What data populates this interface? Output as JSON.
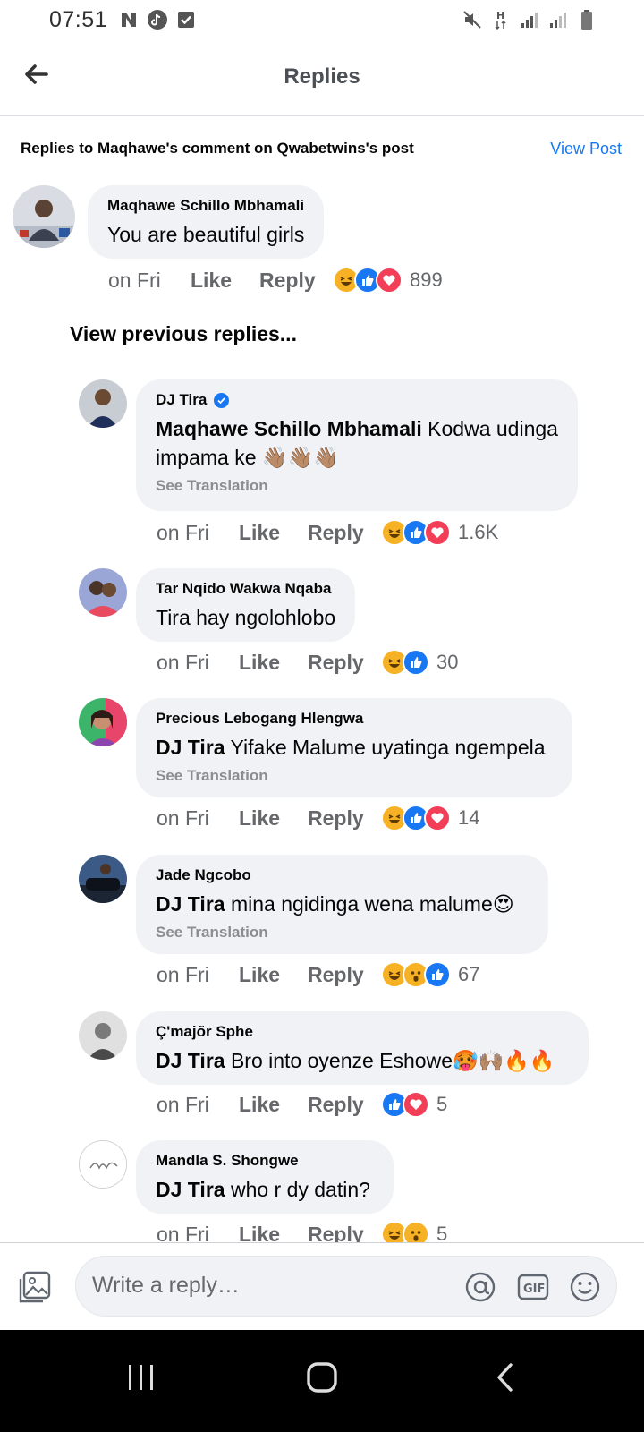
{
  "status_bar": {
    "time": "07:51",
    "left_icons": [
      "netflix-n-icon",
      "tiktok-icon",
      "checkbox-icon"
    ],
    "right_icons": [
      "mute-icon",
      "data-h-icon",
      "signal-icon",
      "signal-icon",
      "battery-icon"
    ]
  },
  "header": {
    "back_icon": "arrow-left-icon",
    "title": "Replies"
  },
  "context": {
    "text": "Replies to Maqhawe's comment on Qwabetwins's post",
    "view_post": "View Post"
  },
  "main_comment": {
    "author": "Maqhawe Schillo Mbhamali",
    "text": "You are beautiful girls",
    "time": "on Fri",
    "like_label": "Like",
    "reply_label": "Reply",
    "reactions": [
      "haha",
      "like",
      "love"
    ],
    "reaction_count": "899"
  },
  "view_previous": "View previous replies...",
  "replies": [
    {
      "author": "DJ Tira",
      "verified": true,
      "mention": "Maqhawe Schillo Mbhamali",
      "text": "Kodwa udinga impama ke 👋🏽👋🏽👋🏽",
      "see_translation": "See Translation",
      "time": "on Fri",
      "like_label": "Like",
      "reply_label": "Reply",
      "reactions": [
        "haha",
        "like",
        "love"
      ],
      "reaction_count": "1.6K"
    },
    {
      "author": "Tar Nqido Wakwa Nqaba",
      "verified": false,
      "mention": "",
      "text": "Tira hay ngolohlobo",
      "see_translation": "",
      "time": "on Fri",
      "like_label": "Like",
      "reply_label": "Reply",
      "reactions": [
        "haha",
        "like"
      ],
      "reaction_count": "30"
    },
    {
      "author": "Precious Lebogang Hlengwa",
      "verified": false,
      "mention": "DJ Tira",
      "text": "Yifake Malume uyatinga ngempela",
      "see_translation": "See Translation",
      "time": "on Fri",
      "like_label": "Like",
      "reply_label": "Reply",
      "reactions": [
        "haha",
        "like",
        "love"
      ],
      "reaction_count": "14"
    },
    {
      "author": "Jade Ngcobo",
      "verified": false,
      "mention": "DJ Tira",
      "text": "mina ngidinga wena malume😍",
      "see_translation": "See Translation",
      "time": "on Fri",
      "like_label": "Like",
      "reply_label": "Reply",
      "reactions": [
        "haha",
        "wow",
        "like"
      ],
      "reaction_count": "67"
    },
    {
      "author": "Ç'majõr Sphe",
      "verified": false,
      "mention": "DJ Tira",
      "text": "Bro into oyenze Eshowe🥵🙌🏽🔥🔥",
      "see_translation": "",
      "time": "on Fri",
      "like_label": "Like",
      "reply_label": "Reply",
      "reactions": [
        "like",
        "love"
      ],
      "reaction_count": "5"
    },
    {
      "author": "Mandla S. Shongwe",
      "verified": false,
      "mention": "DJ Tira",
      "text": "who r dy datin?",
      "see_translation": "",
      "time": "on Fri",
      "like_label": "Like",
      "reply_label": "Reply",
      "reactions": [
        "haha",
        "wow"
      ],
      "reaction_count": "5"
    }
  ],
  "compose": {
    "photo_icon": "photo-icon",
    "placeholder": "Write a reply…",
    "icons": [
      "at-mention-icon",
      "gif-icon",
      "emoji-icon"
    ]
  },
  "colors": {
    "accent": "#1877f2",
    "bubble": "#f0f2f5",
    "meta": "#65676b",
    "love": "#f33e58",
    "haha": "#f7b125"
  },
  "nav_bar": {
    "icons": [
      "recent-apps-icon",
      "home-icon",
      "back-icon"
    ]
  }
}
